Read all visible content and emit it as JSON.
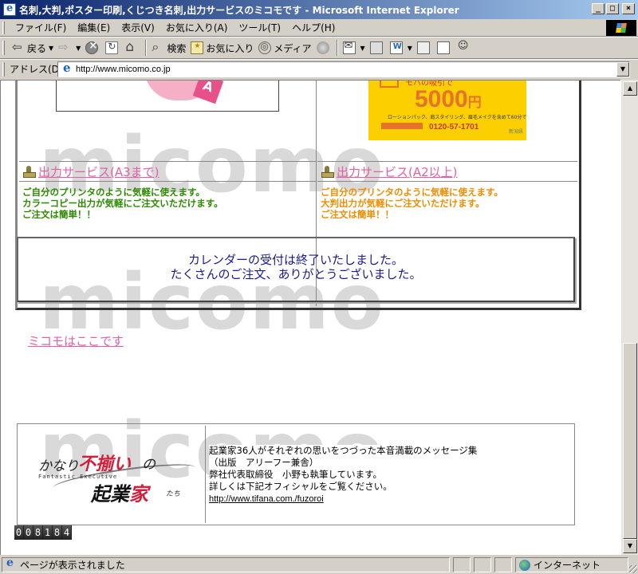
{
  "window": {
    "title": "名刺,大判,ポスター印刷,くじつき名刺,出力サービスのミコモです - Microsoft Internet Explorer",
    "minimize": "_",
    "maximize": "□",
    "close": "×"
  },
  "menu": [
    "ファイル(F)",
    "編集(E)",
    "表示(V)",
    "お気に入り(A)",
    "ツール(T)",
    "ヘルプ(H)"
  ],
  "toolbar": {
    "back_label": "戻る",
    "search_label": "検索",
    "favorites_label": "お気に入り",
    "media_label": "メディア"
  },
  "address": {
    "label": "アドレス(D)",
    "url": "http://www.micomo.co.jp"
  },
  "watermark": "micomo",
  "services": {
    "left": {
      "link": "出力サービス(A3まで)",
      "lines": [
        "ご自分のプリンタのように気軽に使えます。",
        "カラーコピー出力が気軽にご注文いただけます。",
        "ご注文は簡単！！"
      ]
    },
    "right": {
      "link": "出力サービス(A2以上)",
      "lines": [
        "ご自分のプリンタのように気軽に使えます。",
        "大判出力が気軽にご注文いただけます。",
        "ご注文は簡単！！"
      ],
      "ad": {
        "top_text": "モバの吸引で",
        "price": "5000",
        "unit": "円",
        "small_text": "ローションパック、肩スタイリング、眉毛メイクを含めて60分です",
        "phone": "0120-57-1701",
        "corner": "新潟県"
      }
    }
  },
  "notice": {
    "line1": "カレンダーの受付は終了いたしました。",
    "line2": "たくさんのご注文、ありがとうございました。"
  },
  "map_link": "ミコモはここです",
  "book": {
    "logo": {
      "w1": "かなり",
      "w2": "不揃い",
      "w3": "の",
      "sub": "Fantastic Executive",
      "w5a": "起業",
      "w5b": "家",
      "w6": "たち"
    },
    "lines": [
      "起業家36人がそれぞれの思いをつづった本音満載のメッセージ集",
      "（出版　アリーフー兼舎）",
      "弊社代表取締役　小野も執筆しています。",
      "詳しくは下記オフィシャルをご覧ください。"
    ],
    "link": "http://www.tifana.com./fuzoroi"
  },
  "counter": [
    "0",
    "0",
    "8",
    "1",
    "8",
    "4"
  ],
  "status": {
    "message": "ページが表示されました",
    "zone": "インターネット"
  }
}
